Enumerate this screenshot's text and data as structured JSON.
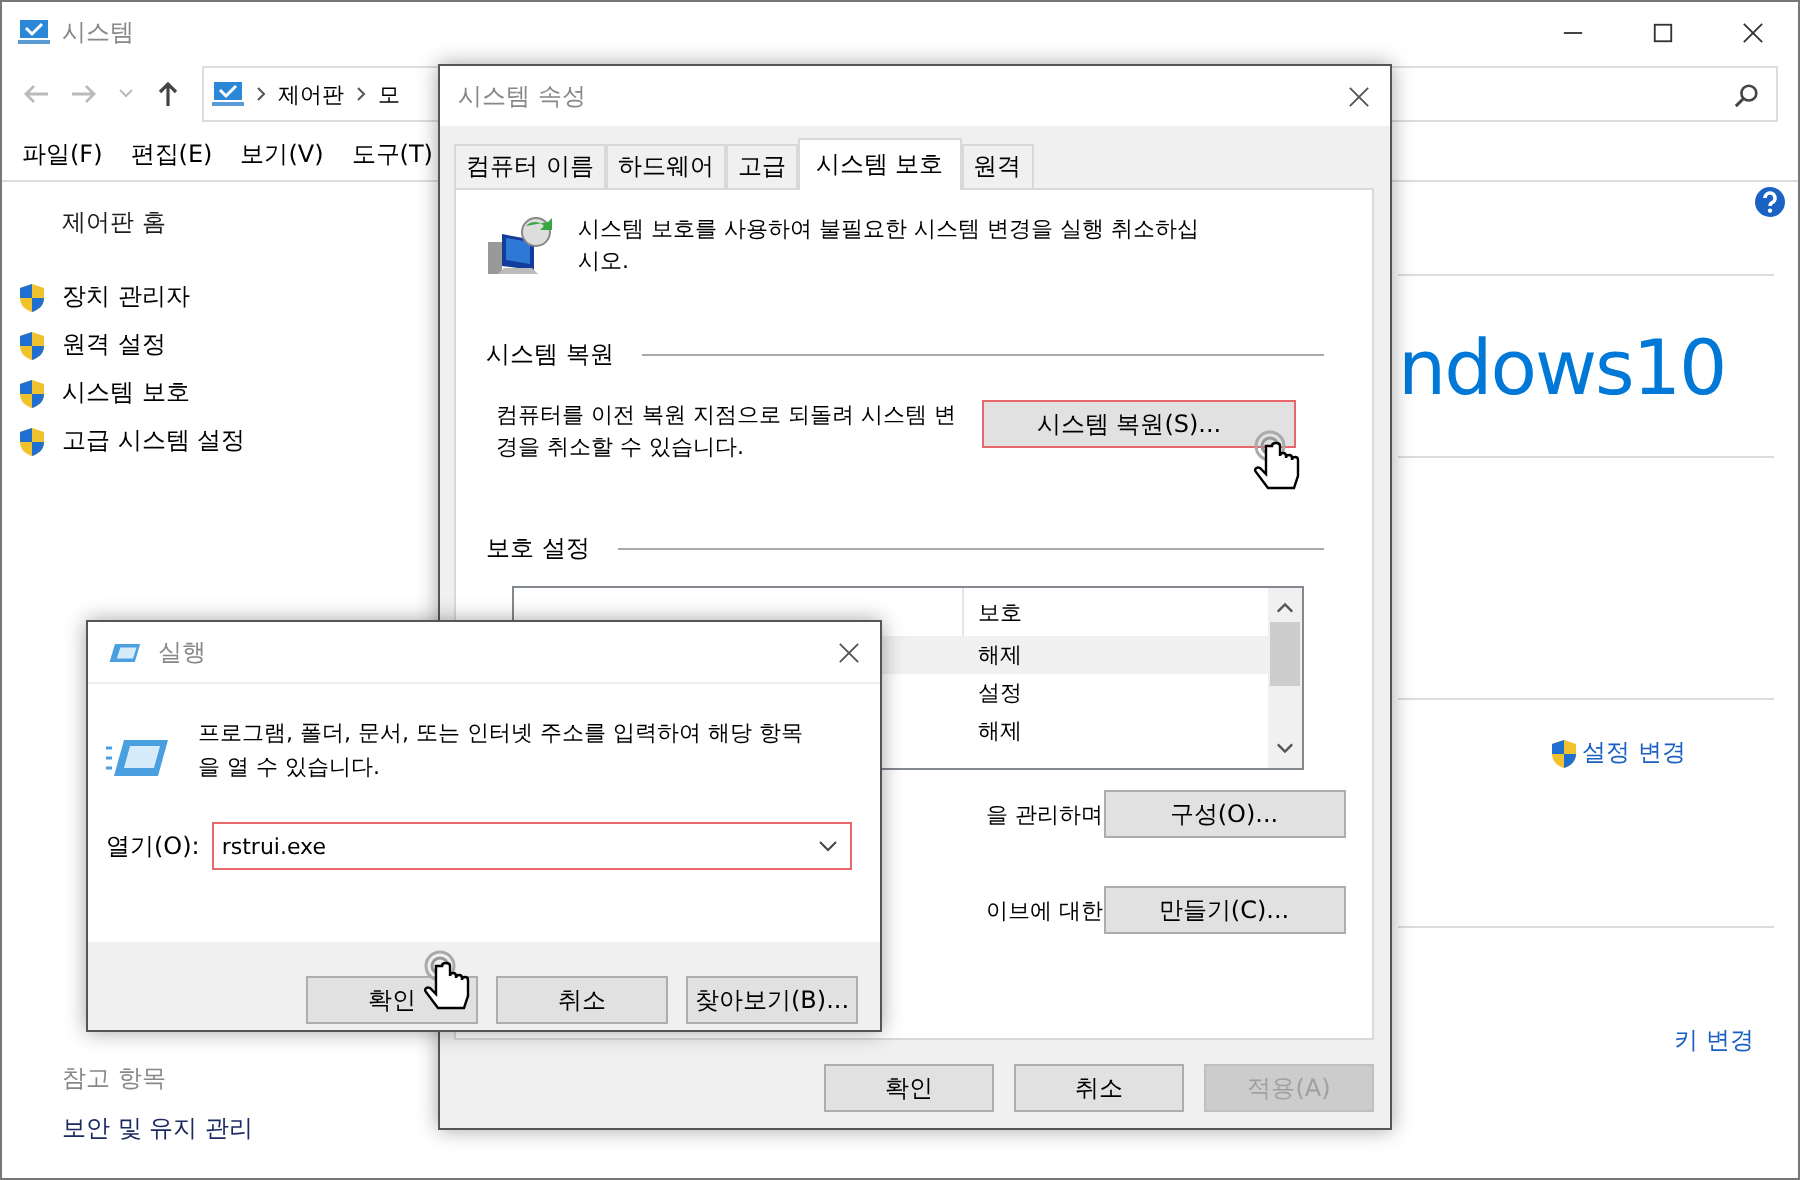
{
  "main_window": {
    "title": "시스템",
    "breadcrumb": [
      "제어판",
      "모"
    ],
    "menu": [
      "파일(F)",
      "편집(E)",
      "보기(V)",
      "도구(T)"
    ],
    "sidebar": {
      "home": "제어판 홈",
      "links": [
        "장치 관리자",
        "원격 설정",
        "시스템 보호",
        "고급 시스템 설정"
      ]
    },
    "see_also": {
      "heading": "참고 항목",
      "links": [
        "보안 및 유지 관리"
      ]
    },
    "logo_text": "ndows10",
    "change_settings": "설정 변경",
    "product_key": "키 변경"
  },
  "properties_dialog": {
    "title": "시스템 속성",
    "tabs": [
      {
        "label": "컴퓨터 이름",
        "selected": false
      },
      {
        "label": "하드웨어",
        "selected": false
      },
      {
        "label": "고급",
        "selected": false
      },
      {
        "label": "시스템 보호",
        "selected": true
      },
      {
        "label": "원격",
        "selected": false
      }
    ],
    "intro": "시스템 보호를 사용하여 불필요한 시스템 변경을 실행 취소하십시오.",
    "restore": {
      "heading": "시스템 복원",
      "description": "컴퓨터를 이전 복원 지점으로 되돌려 시스템 변경을 취소할 수 있습니다.",
      "button": "시스템 복원(S)..."
    },
    "protection": {
      "heading": "보호 설정",
      "column": "보호",
      "rows": [
        {
          "value": "해제",
          "selected": true
        },
        {
          "value": "설정",
          "selected": false
        },
        {
          "value": "해제",
          "selected": false
        }
      ],
      "configure_text": "을 관리하며",
      "configure_button": "구성(O)...",
      "create_text": "이브에 대한",
      "create_button": "만들기(C)..."
    },
    "buttons": [
      {
        "label": "확인",
        "disabled": false
      },
      {
        "label": "취소",
        "disabled": false
      },
      {
        "label": "적용(A)",
        "disabled": true
      }
    ]
  },
  "run_dialog": {
    "title": "실행",
    "description": "프로그램, 폴더, 문서, 또는 인터넷 주소를 입력하여 해당 항목을 열 수 있습니다.",
    "open_label": "열기(O):",
    "value": "rstrui.exe",
    "buttons": [
      "확인",
      "취소",
      "찾아보기(B)..."
    ]
  }
}
